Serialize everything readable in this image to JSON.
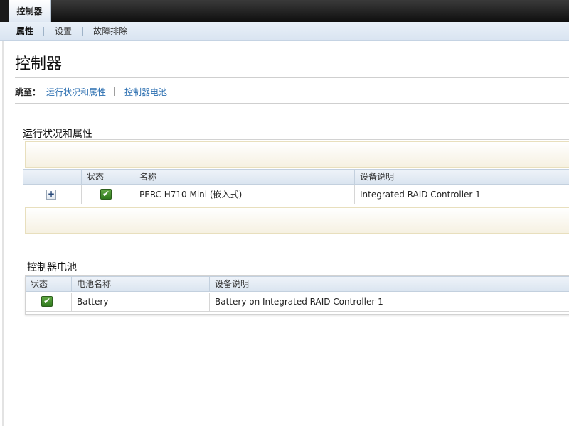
{
  "tabs": {
    "active": "控制器"
  },
  "subnav": {
    "items": [
      "属性",
      "设置",
      "故障排除"
    ]
  },
  "page": {
    "title": "控制器"
  },
  "jump": {
    "label": "跳至：",
    "links": [
      "运行状况和属性",
      "控制器电池"
    ],
    "separator": "|"
  },
  "health": {
    "title": "运行状况和属性",
    "columns": [
      "状态",
      "名称",
      "设备说明"
    ],
    "rows": [
      {
        "status": "ok",
        "name": "PERC H710 Mini (嵌入式)",
        "description": "Integrated RAID Controller 1"
      }
    ]
  },
  "battery": {
    "title": "控制器电池",
    "columns": [
      "状态",
      "电池名称",
      "设备说明"
    ],
    "rows": [
      {
        "status": "ok",
        "name": "Battery",
        "description": "Battery on Integrated RAID Controller 1"
      }
    ]
  },
  "icons": {
    "expand": "plus-icon",
    "status_ok": "check-icon"
  },
  "colors": {
    "link": "#2a6eb0",
    "status_ok": "#3e8a27"
  }
}
